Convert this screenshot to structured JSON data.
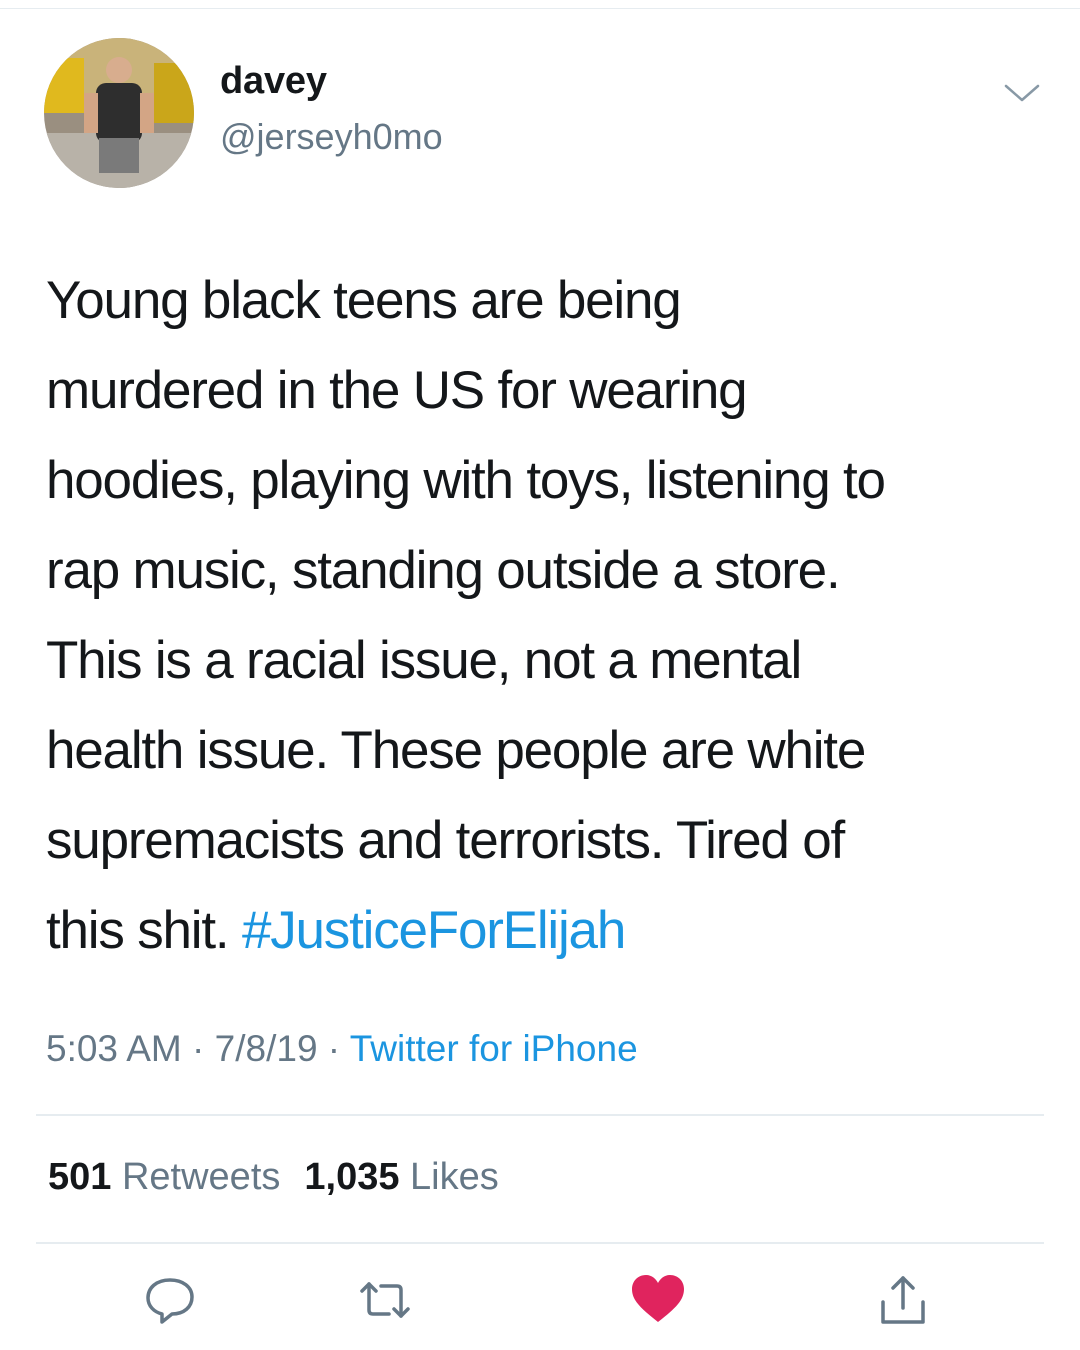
{
  "tweet": {
    "author": {
      "display_name": "davey",
      "handle": "@jerseyh0mo"
    },
    "text_lines": [
      "Young black teens are being",
      "murdered in the US for wearing",
      "hoodies, playing with toys, listening to",
      "rap music, standing outside a store.",
      "This is a racial issue, not a mental",
      "health issue. These people are white",
      "supremacists and terrorists. Tired of"
    ],
    "last_line_prefix": "this shit. ",
    "hashtag": "#JusticeForElijah",
    "time": "5:03 AM",
    "separator": " · ",
    "date": "7/8/19",
    "source": "Twitter for iPhone",
    "retweets_count": "501",
    "retweets_label": "Retweets",
    "likes_count": "1,035",
    "likes_label": "Likes"
  },
  "icons": {
    "caret": "chevron-down-icon",
    "reply": "reply-icon",
    "retweet": "retweet-icon",
    "like": "heart-icon",
    "share": "share-icon"
  },
  "colors": {
    "link": "#1b95e0",
    "secondary_text": "#657786",
    "like_active": "#e0245e",
    "divider": "#e6ecf0"
  }
}
